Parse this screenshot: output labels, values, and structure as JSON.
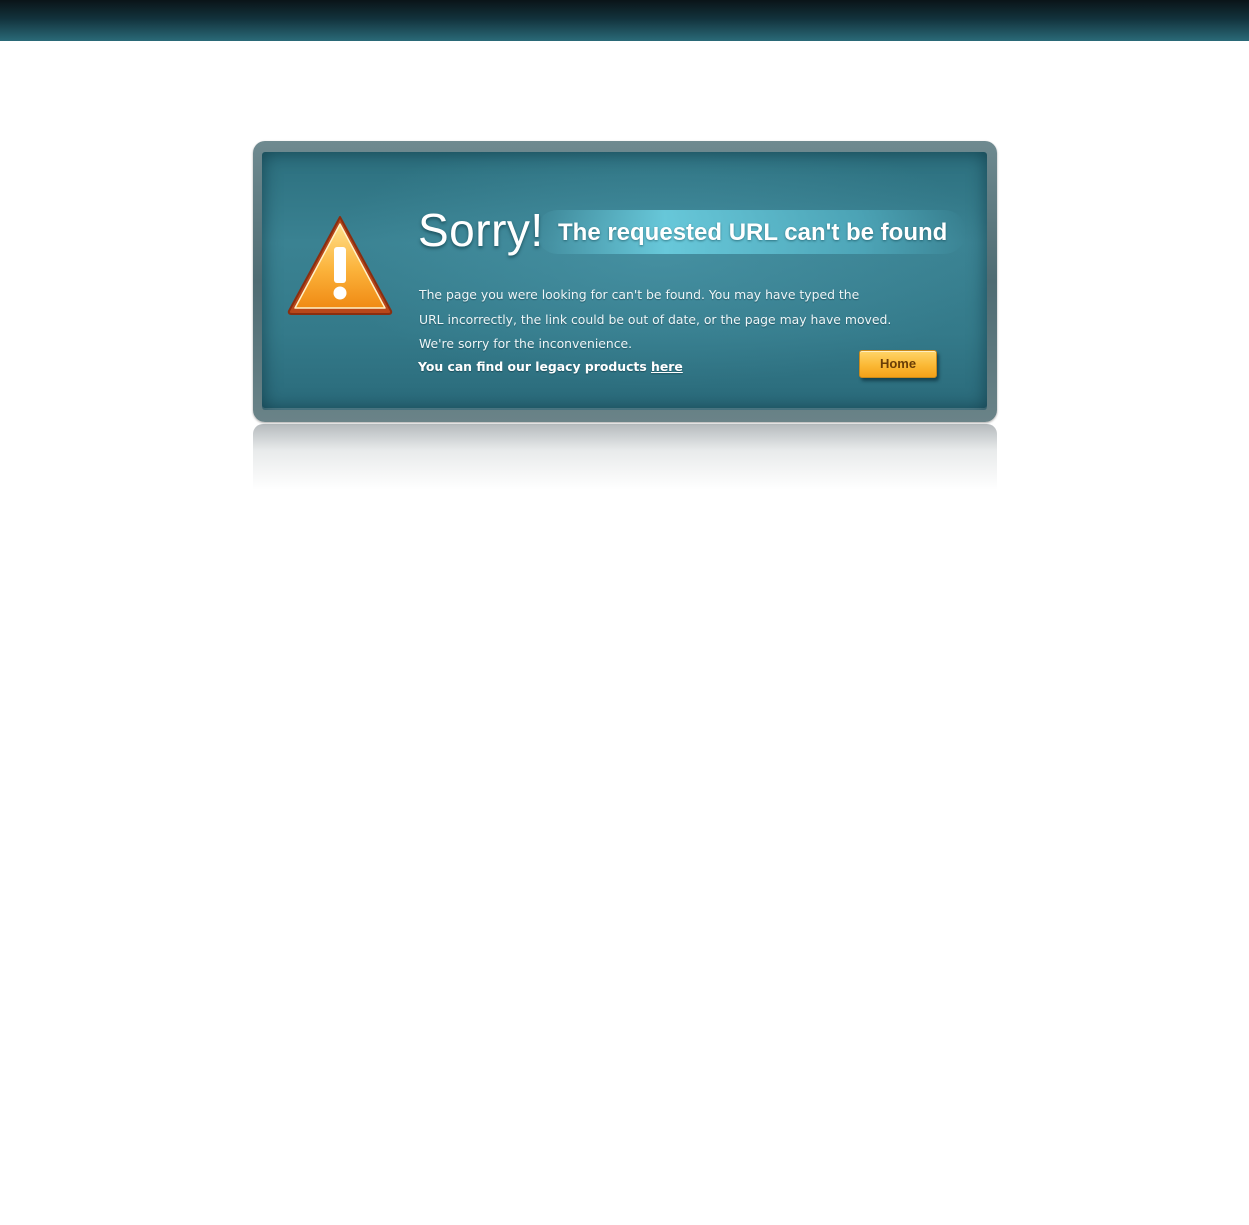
{
  "error": {
    "heading": "Sorry!",
    "subheading": "The requested URL can't be found",
    "message_lines": [
      "The page you were looking for can't be found. You may have typed the",
      "URL incorrectly, the link could be out of date, or the page may have moved.",
      "We're sorry for the inconvenience."
    ],
    "legacy_text": "You can find our legacy products ",
    "legacy_link": "here",
    "home_button": "Home",
    "icon": "warning-icon"
  },
  "colors": {
    "panel_teal": "#347a8a",
    "button_orange": "#fbb935",
    "top_bar": "#12323c"
  }
}
